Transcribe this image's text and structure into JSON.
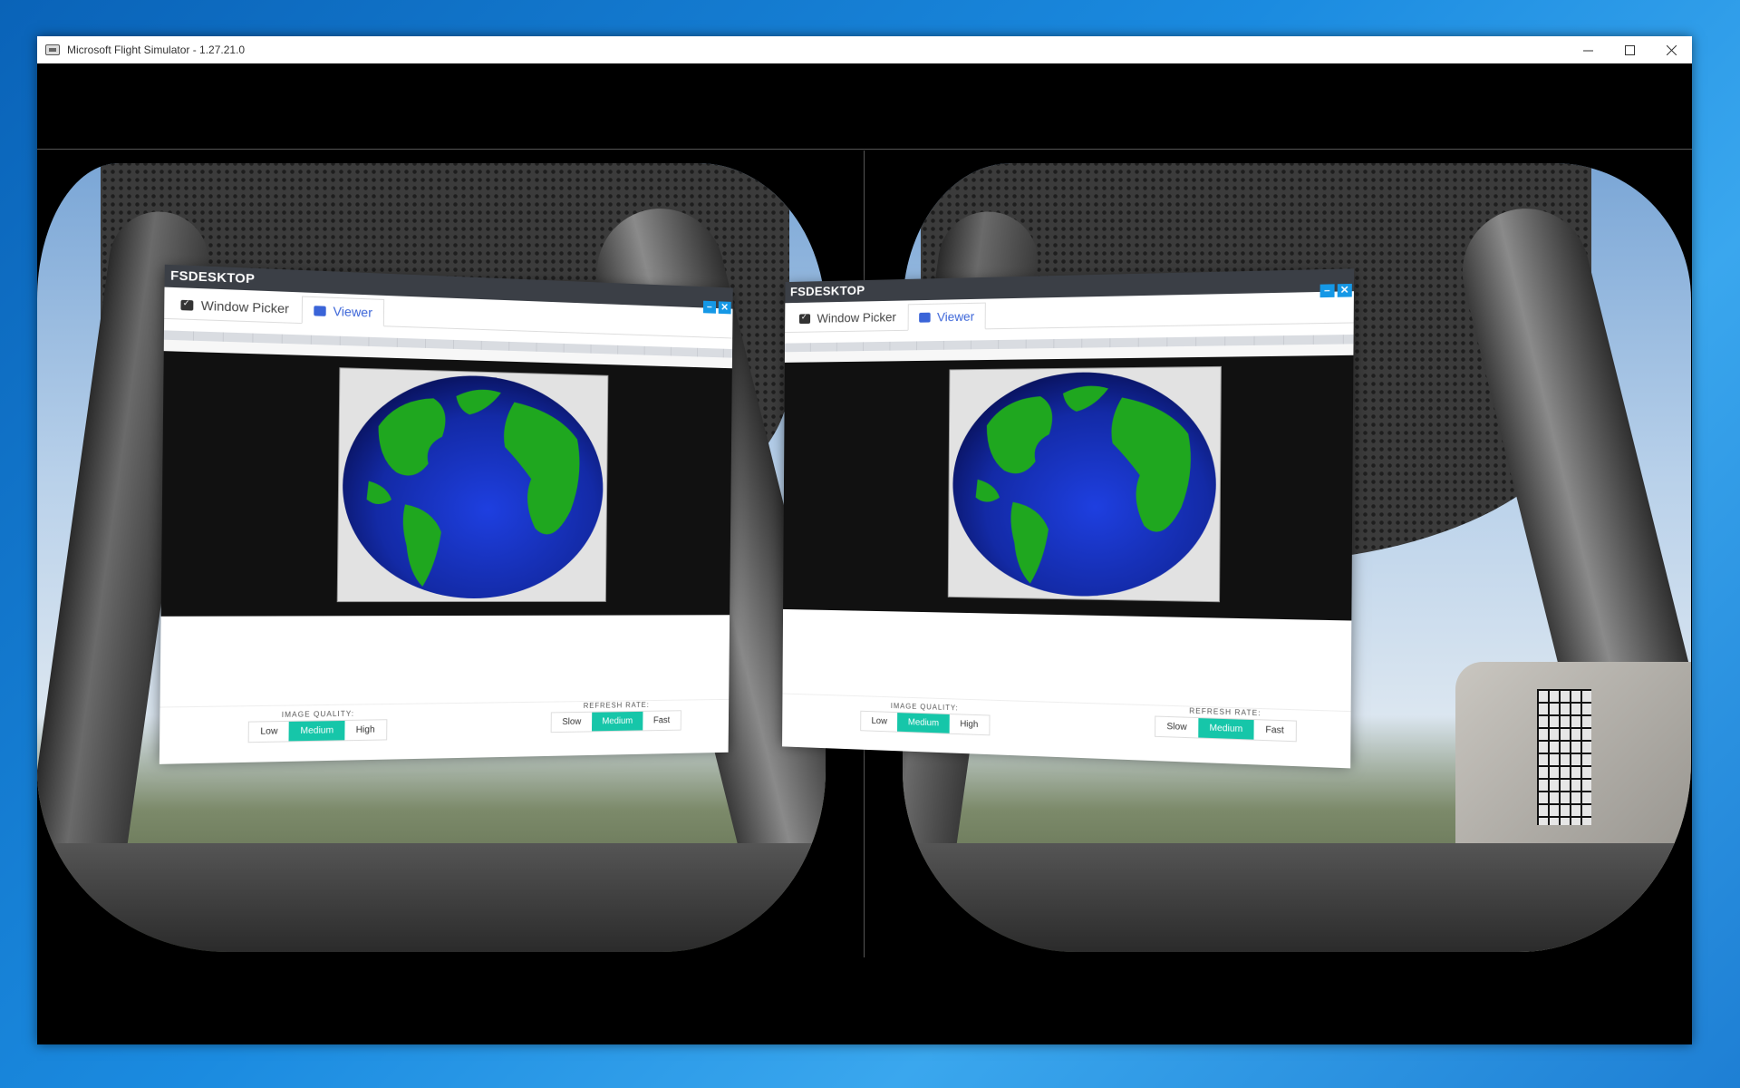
{
  "window": {
    "title": "Microsoft Flight Simulator - 1.27.21.0",
    "controls": [
      "minimize-icon",
      "maximize-icon",
      "close-icon"
    ]
  },
  "fsdesktop": {
    "title": "FSDESKTOP",
    "tabs": [
      {
        "label": "Window Picker",
        "icon": "checkbox-icon",
        "active": false
      },
      {
        "label": "Viewer",
        "icon": "folder-icon",
        "active": true
      }
    ],
    "image_quality": {
      "label": "IMAGE QUALITY:",
      "options": [
        "Low",
        "Medium",
        "High"
      ],
      "selected": "Medium"
    },
    "refresh_rate": {
      "label": "REFRESH RATE:",
      "options": [
        "Slow",
        "Medium",
        "Fast"
      ],
      "selected": "Medium"
    }
  },
  "colors": {
    "accent_teal": "#16c6a9",
    "accent_blue": "#1598e6",
    "tab_active": "#3a64d8",
    "globe_ocean": "#1a2fbf",
    "globe_land": "#1fa71f"
  }
}
